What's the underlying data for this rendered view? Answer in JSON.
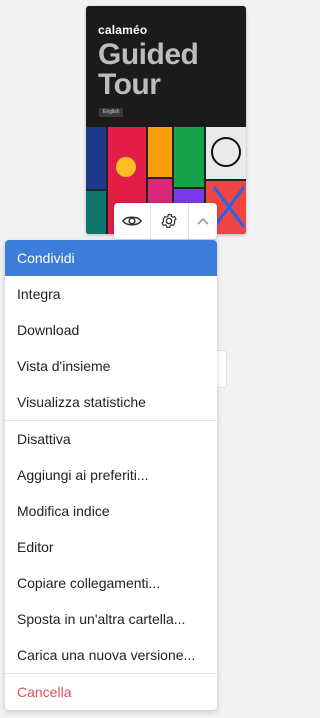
{
  "thumbnail": {
    "brand": "calaméo",
    "title_line1": "Guided",
    "title_line2": "Tour",
    "language_badge": "English"
  },
  "toolbar": {
    "preview_icon": "eye-icon",
    "settings_icon": "gear-icon",
    "collapse_icon": "chevron-up-icon"
  },
  "menu": {
    "group1": [
      {
        "label": "Condividi",
        "active": true
      },
      {
        "label": "Integra"
      },
      {
        "label": "Download"
      },
      {
        "label": "Vista d'insieme"
      },
      {
        "label": "Visualizza statistiche"
      }
    ],
    "group2": [
      {
        "label": "Disattiva"
      },
      {
        "label": "Aggiungi ai preferiti..."
      },
      {
        "label": "Modifica indice"
      },
      {
        "label": "Editor"
      },
      {
        "label": "Copiare collegamenti..."
      },
      {
        "label": "Sposta in un'altra cartella..."
      },
      {
        "label": "Carica una nuova versione..."
      }
    ],
    "group3": [
      {
        "label": "Cancella",
        "danger": true
      }
    ]
  },
  "colors": {
    "accent": "#3b7dd8",
    "danger": "#e04e5b"
  }
}
